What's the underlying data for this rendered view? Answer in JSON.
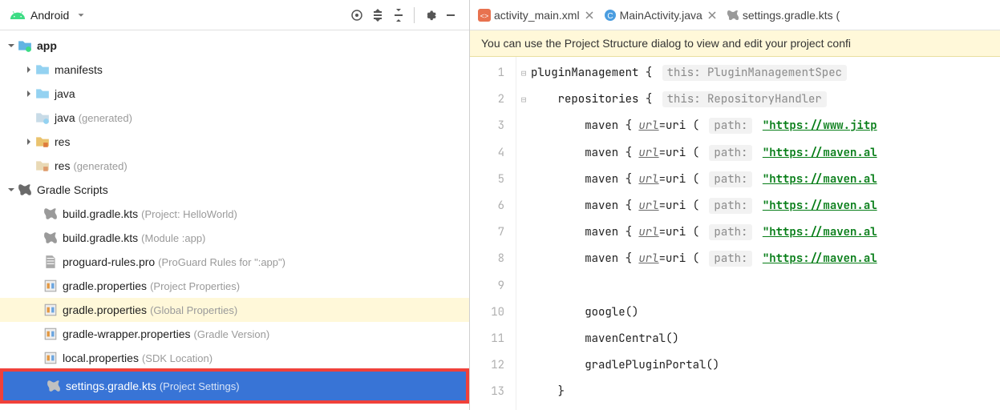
{
  "toolbar": {
    "view": "Android"
  },
  "tree": {
    "app": {
      "name": "app"
    },
    "manifests": {
      "name": "manifests"
    },
    "java": {
      "name": "java"
    },
    "java_gen": {
      "name": "java",
      "suffix": "(generated)"
    },
    "res": {
      "name": "res"
    },
    "res_gen": {
      "name": "res",
      "suffix": "(generated)"
    },
    "gradle_scripts": {
      "name": "Gradle Scripts"
    },
    "build_project": {
      "name": "build.gradle.kts",
      "suffix": "(Project: HelloWorld)"
    },
    "build_module": {
      "name": "build.gradle.kts",
      "suffix": "(Module :app)"
    },
    "proguard": {
      "name": "proguard-rules.pro",
      "suffix": "(ProGuard Rules for \":app\")"
    },
    "gradle_props": {
      "name": "gradle.properties",
      "suffix": "(Project Properties)"
    },
    "gradle_props_global": {
      "name": "gradle.properties",
      "suffix": "(Global Properties)"
    },
    "wrapper": {
      "name": "gradle-wrapper.properties",
      "suffix": "(Gradle Version)"
    },
    "local": {
      "name": "local.properties",
      "suffix": "(SDK Location)"
    },
    "settings": {
      "name": "settings.gradle.kts",
      "suffix": "(Project Settings)"
    }
  },
  "tabs": [
    {
      "icon": "xml",
      "label": "activity_main.xml"
    },
    {
      "icon": "java",
      "label": "MainActivity.java"
    },
    {
      "icon": "gradle",
      "label": "settings.gradle.kts ("
    }
  ],
  "banner": "You can use the Project Structure dialog to view and edit your project confi",
  "code": {
    "lines": [
      {
        "n": 1,
        "fold": "⊟",
        "text_kw": "pluginManagement",
        "text_rest": " {",
        "hint": "this: PluginManagementSpec"
      },
      {
        "n": 2,
        "fold": "⊟",
        "indent": 1,
        "text_kw": "repositories",
        "text_rest": " {",
        "hint": "this: RepositoryHandler"
      },
      {
        "n": 3,
        "indent": 2,
        "maven": true,
        "url_label": "url",
        "arg_hint": "path:",
        "url_val": "\"https://www.jitp"
      },
      {
        "n": 4,
        "indent": 2,
        "maven": true,
        "url_label": "url",
        "arg_hint": "path:",
        "url_val": "\"https://maven.al"
      },
      {
        "n": 5,
        "indent": 2,
        "maven": true,
        "url_label": "url",
        "arg_hint": "path:",
        "url_val": "\"https://maven.al"
      },
      {
        "n": 6,
        "indent": 2,
        "maven": true,
        "url_label": "url",
        "arg_hint": "path:",
        "url_val": "\"https://maven.al"
      },
      {
        "n": 7,
        "indent": 2,
        "maven": true,
        "url_label": "url",
        "arg_hint": "path:",
        "url_val": "\"https://maven.al"
      },
      {
        "n": 8,
        "indent": 2,
        "maven": true,
        "url_label": "url",
        "arg_hint": "path:",
        "url_val": "\"https://maven.al"
      },
      {
        "n": 9,
        "blank": true
      },
      {
        "n": 10,
        "indent": 2,
        "call": "google()"
      },
      {
        "n": 11,
        "indent": 2,
        "call": "mavenCentral()"
      },
      {
        "n": 12,
        "indent": 2,
        "call": "gradlePluginPortal()"
      },
      {
        "n": 13,
        "indent": 1,
        "close": "}"
      }
    ]
  }
}
